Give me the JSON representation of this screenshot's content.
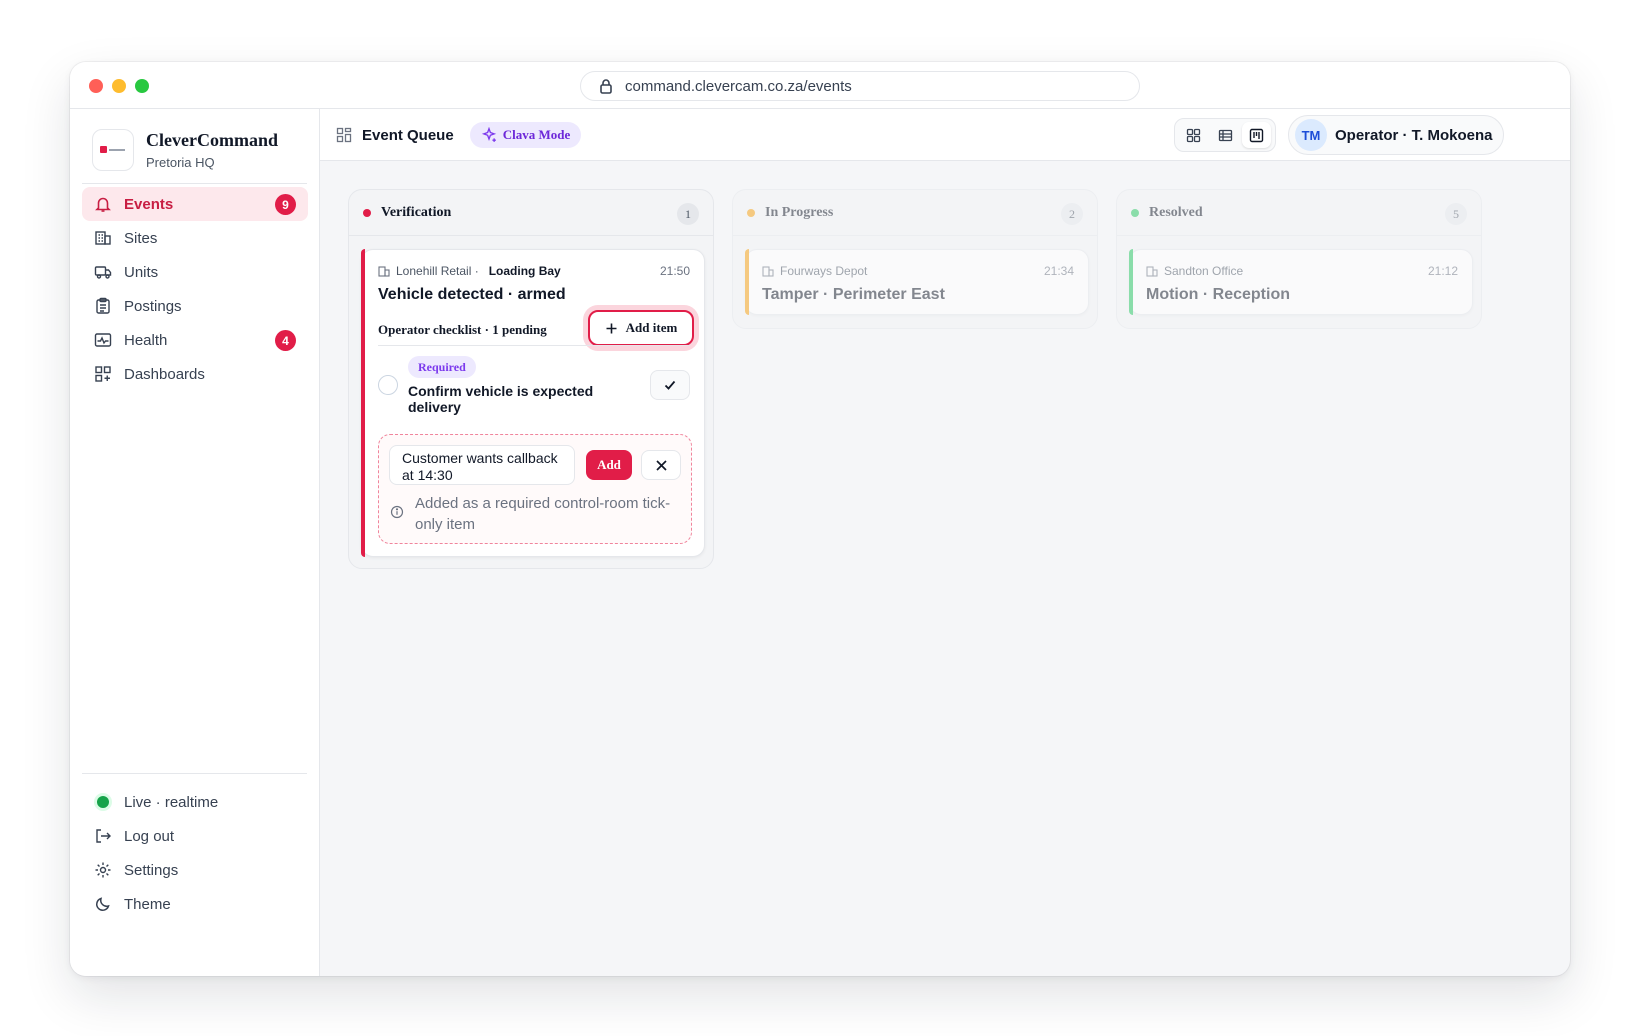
{
  "browser": {
    "url": "command.clevercam.co.za/events"
  },
  "sidebar": {
    "brand_name": "CleverCommand",
    "brand_sub": "Pretoria HQ",
    "items": [
      {
        "label": "Events",
        "icon": "bell-icon",
        "badge": "9",
        "active": true
      },
      {
        "label": "Sites",
        "icon": "building-icon"
      },
      {
        "label": "Units",
        "icon": "truck-icon"
      },
      {
        "label": "Postings",
        "icon": "clipboard-icon"
      },
      {
        "label": "Health",
        "icon": "pulse-icon",
        "badge": "4"
      },
      {
        "label": "Dashboards",
        "icon": "dashboard-icon"
      }
    ],
    "bottom": [
      {
        "label": "Live · realtime",
        "icon": "live-dot"
      },
      {
        "label": "Log out",
        "icon": "logout-icon"
      },
      {
        "label": "Settings",
        "icon": "gear-icon"
      },
      {
        "label": "Theme",
        "icon": "moon-icon"
      }
    ]
  },
  "topbar": {
    "title": "Event Queue",
    "mode_label": "Clava Mode",
    "user_initials": "TM",
    "user_label": "Operator · T. Mokoena"
  },
  "columns": [
    {
      "title": "Verification",
      "count": "1",
      "color": "#e11d48",
      "cards": [
        {
          "site": "Lonehill Retail ·",
          "zone": "Loading Bay",
          "time": "21:50",
          "title": "Vehicle detected · armed",
          "checklist_title": "Operator checklist · 1 pending",
          "add_item_label": "Add item",
          "item": {
            "tag": "Required",
            "text": "Confirm vehicle is expected delivery"
          },
          "form": {
            "input_value": "Customer wants callback at 14:30",
            "add_label": "Add",
            "hint": "Added as a required control-room tick-only item"
          }
        }
      ]
    },
    {
      "title": "In Progress",
      "count": "2",
      "color": "#f59e0b",
      "cards": [
        {
          "site": "Fourways Depot",
          "time": "21:34",
          "title": "Tamper · Perimeter East"
        }
      ]
    },
    {
      "title": "Resolved",
      "count": "5",
      "color": "#22c55e",
      "cards": [
        {
          "site": "Sandton Office",
          "time": "21:12",
          "title": "Motion · Reception"
        }
      ]
    }
  ],
  "colors": {
    "accent": "#e11d48",
    "purple": "#7c3aed",
    "live": "#16a34a"
  }
}
